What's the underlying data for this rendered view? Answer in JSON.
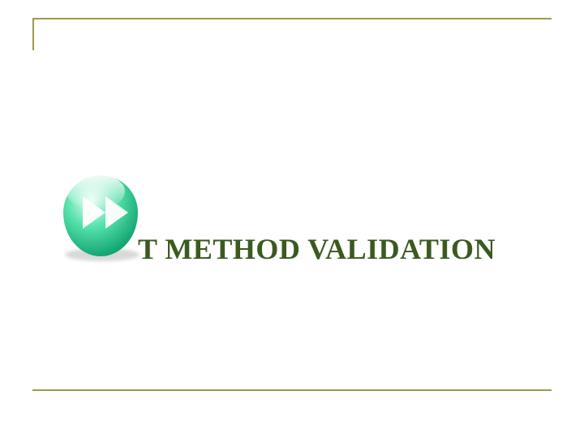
{
  "title": "T METHOD VALIDATION",
  "icon": "fast-forward-icon",
  "colors": {
    "rule": "#9c9b4e",
    "title": "#3a5a1f",
    "iconGradTop": "#d7fff0",
    "iconGradBottom": "#0fbf82"
  }
}
